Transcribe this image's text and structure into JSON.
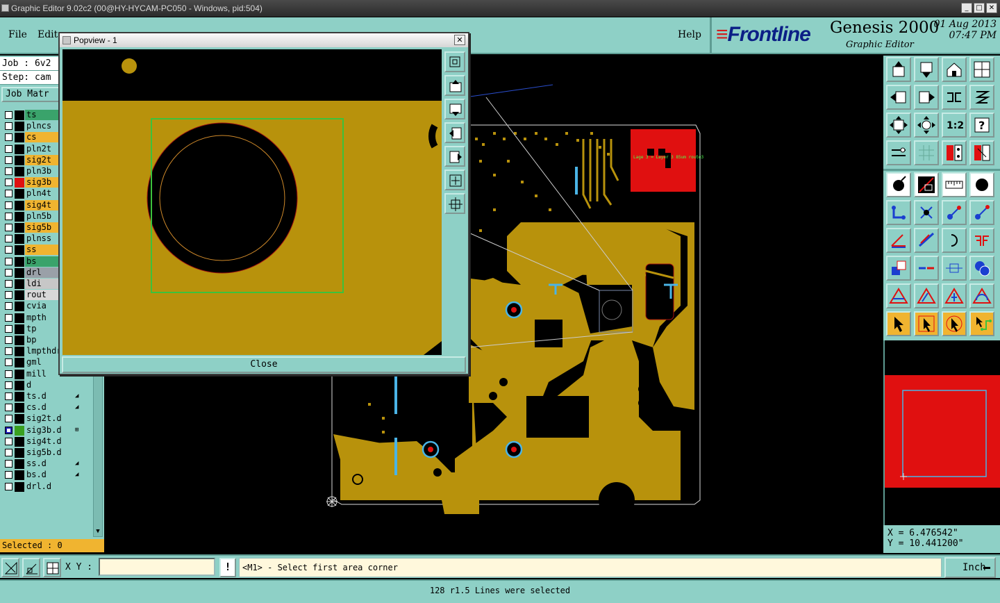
{
  "window": {
    "title": "Graphic Editor 9.02c2 (00@HY-HYCAM-PC050 - Windows, pid:504)",
    "controls": [
      "_",
      "□",
      "✕"
    ]
  },
  "menu": {
    "file": "File",
    "edit": "Edit",
    "help": "Help"
  },
  "brand": {
    "logo": "Frontline",
    "product": "Genesis 2000",
    "subtitle": "Graphic Editor",
    "date": "01 Aug 2013",
    "time": "07:47 PM"
  },
  "left_panel": {
    "job": "Job : 6v2",
    "step": "Step: cam",
    "job_matrix": "Job Matr",
    "selected": "Selected : 0",
    "layers": [
      {
        "name": "ts",
        "bg": "#3aa36b",
        "swatch": "#000",
        "checked": false
      },
      {
        "name": "plncs",
        "bg": "#8ed0c6",
        "swatch": "#000",
        "checked": false
      },
      {
        "name": "cs",
        "bg": "#f0b430",
        "swatch": "#000",
        "checked": false
      },
      {
        "name": "pln2t",
        "bg": "#8ed0c6",
        "swatch": "#000",
        "checked": false
      },
      {
        "name": "sig2t",
        "bg": "#f0b430",
        "swatch": "#000",
        "checked": false
      },
      {
        "name": "pln3b",
        "bg": "#8ed0c6",
        "swatch": "#000",
        "checked": false
      },
      {
        "name": "sig3b",
        "bg": "#f0b430",
        "swatch": "#e01010",
        "checked": false
      },
      {
        "name": "pln4t",
        "bg": "#8ed0c6",
        "swatch": "#000",
        "checked": false
      },
      {
        "name": "sig4t",
        "bg": "#f0b430",
        "swatch": "#000",
        "checked": false
      },
      {
        "name": "pln5b",
        "bg": "#8ed0c6",
        "swatch": "#000",
        "checked": false
      },
      {
        "name": "sig5b",
        "bg": "#f0b430",
        "swatch": "#000",
        "checked": false
      },
      {
        "name": "plnss",
        "bg": "#8ed0c6",
        "swatch": "#000",
        "checked": false
      },
      {
        "name": "ss",
        "bg": "#f0b430",
        "swatch": "#000",
        "checked": false
      },
      {
        "name": "bs",
        "bg": "#3aa36b",
        "swatch": "#000",
        "checked": false
      },
      {
        "name": "drl",
        "bg": "#9aa0a8",
        "swatch": "#000",
        "checked": false
      },
      {
        "name": "ldi",
        "bg": "#c7c7c7",
        "swatch": "#000",
        "checked": false
      },
      {
        "name": "rout",
        "bg": "#d8d8d8",
        "swatch": "#000",
        "checked": false
      },
      {
        "name": "cvia",
        "bg": "#8ed0c6",
        "swatch": "#000",
        "checked": false
      },
      {
        "name": "mpth",
        "bg": "#8ed0c6",
        "swatch": "#000",
        "checked": false
      },
      {
        "name": "tp",
        "bg": "#8ed0c6",
        "swatch": "#000",
        "checked": false
      },
      {
        "name": "bp",
        "bg": "#8ed0c6",
        "swatch": "#000",
        "checked": false
      },
      {
        "name": "lmpthdrl",
        "bg": "#8ed0c6",
        "swatch": "#000",
        "checked": false
      },
      {
        "name": "gml",
        "bg": "#8ed0c6",
        "swatch": "#000",
        "checked": false
      },
      {
        "name": "mill",
        "bg": "#8ed0c6",
        "swatch": "#000",
        "checked": false
      },
      {
        "name": "d",
        "bg": "#8ed0c6",
        "swatch": "#000",
        "checked": false
      },
      {
        "name": "ts.d",
        "bg": "#8ed0c6",
        "swatch": "#000",
        "checked": false,
        "mark": "◢"
      },
      {
        "name": "cs.d",
        "bg": "#8ed0c6",
        "swatch": "#000",
        "checked": false,
        "mark": "◢"
      },
      {
        "name": "sig2t.d",
        "bg": "#8ed0c6",
        "swatch": "#000",
        "checked": false
      },
      {
        "name": "sig3b.d",
        "bg": "#8ed0c6",
        "swatch": "#3aa020",
        "checked": true,
        "mark": "⊞"
      },
      {
        "name": "sig4t.d",
        "bg": "#8ed0c6",
        "swatch": "#000",
        "checked": false
      },
      {
        "name": "sig5b.d",
        "bg": "#8ed0c6",
        "swatch": "#000",
        "checked": false
      },
      {
        "name": "ss.d",
        "bg": "#8ed0c6",
        "swatch": "#000",
        "checked": false,
        "mark": "◢"
      },
      {
        "name": "bs.d",
        "bg": "#8ed0c6",
        "swatch": "#000",
        "checked": false,
        "mark": "◢"
      },
      {
        "name": "drl.d",
        "bg": "#8ed0c6",
        "swatch": "#000",
        "checked": false
      }
    ]
  },
  "popview": {
    "title": "Popview - 1",
    "close_x": "✕",
    "close_button": "Close"
  },
  "canvas": {
    "annotation": "Lage 3 = Layer 3 85um route3",
    "colors": {
      "copper": "#b8920c",
      "background": "#000000",
      "pad_ring": "#4ab4e6",
      "drill": "#e01010",
      "highlight": "#e01010"
    }
  },
  "coords": {
    "x": "X = 6.476542\"",
    "y": "Y = 10.441200\""
  },
  "command": {
    "xy_label": "X Y :",
    "xy_value": "",
    "warn": "!",
    "prompt": "<M1> - Select first area corner",
    "unit": "Inch"
  },
  "status": "128 r1.5 Lines were selected"
}
